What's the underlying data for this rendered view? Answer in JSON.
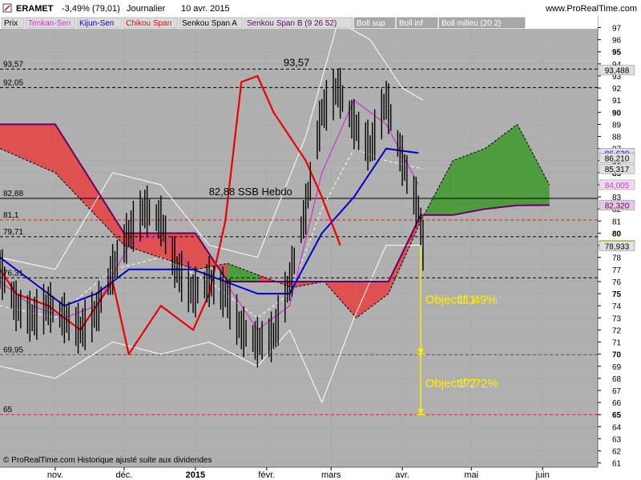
{
  "header": {
    "symbol": "ERAMET",
    "change": "-3,49% (79,01)",
    "period": "Journalier",
    "date": "10 avr. 2015",
    "site": "www.ProRealTime.com"
  },
  "legend": [
    {
      "label": "Prix",
      "color": "#000000",
      "bg": "#dcdcdc"
    },
    {
      "label": "Tenkan-Sen",
      "color": "#cc33cc",
      "bg": "#dcdcdc"
    },
    {
      "label": "Kijun-Sen",
      "color": "#0000cc",
      "bg": "#dcdcdc"
    },
    {
      "label": "Chikou Span",
      "color": "#ee0000",
      "bg": "#dcdcdc"
    },
    {
      "label": "Senkou Span A",
      "color": "#000000",
      "bg": "#dcdcdc"
    },
    {
      "label": "Senkou Span B (9 26 52)",
      "color": "#660066",
      "bg": "#dcdcdc"
    },
    {
      "label": "Boll sup",
      "color": "#ffffff",
      "bg": "#a8a8a8"
    },
    {
      "label": "Boll inf",
      "color": "#ffffff",
      "bg": "#a8a8a8"
    },
    {
      "label": "Boll milieu (20 2)",
      "color": "#ffffff",
      "bg": "#a8a8a8"
    }
  ],
  "footer": "© ProRealTime.com Historique ajusté suite aux dividendes",
  "colors": {
    "plot_bg": "#b0b0b0",
    "price": "#000000",
    "tenkan": "#cc33cc",
    "kijun": "#0000cc",
    "chikou": "#ee0000",
    "ssb": "#660066",
    "boll": "#ffffff",
    "cloud_bear": "#e84040",
    "cloud_bull": "#3c9a2a",
    "objective": "#ffee00"
  },
  "chart_data": {
    "type": "candlestick",
    "y_range": [
      61,
      97
    ],
    "y_ticks": [
      61,
      62,
      63,
      64,
      65,
      66,
      67,
      68,
      69,
      70,
      71,
      72,
      73,
      74,
      75,
      76,
      77,
      78,
      79,
      80,
      81,
      82,
      83,
      84,
      85,
      86,
      87,
      88,
      89,
      90,
      91,
      92,
      93,
      94,
      95,
      96,
      97
    ],
    "y_bold_ticks": [
      65,
      70,
      75,
      80,
      85,
      90,
      95
    ],
    "x_labels": [
      {
        "date": "2014-11-01",
        "label": "nov."
      },
      {
        "date": "2014-12-01",
        "label": "déc."
      },
      {
        "date": "2015-01-01",
        "label": "2015"
      },
      {
        "date": "2015-02-01",
        "label": "févr."
      },
      {
        "date": "2015-03-01",
        "label": "mars"
      },
      {
        "date": "2015-04-01",
        "label": "avr."
      },
      {
        "date": "2015-05-01",
        "label": "mai"
      },
      {
        "date": "2015-06-01",
        "label": "juin"
      }
    ],
    "x_range": [
      "2014-10-08",
      "2015-06-25"
    ],
    "levels": [
      {
        "value": 93.57,
        "label": "93,57",
        "style": "dashed-black"
      },
      {
        "value": 92.05,
        "label": "92,05",
        "style": "dashed-black"
      },
      {
        "value": 82.88,
        "label": "82,88",
        "style": "solid-black"
      },
      {
        "value": 81.1,
        "label": "81,1",
        "style": "dashed-red"
      },
      {
        "value": 79.71,
        "label": "79,71",
        "style": "dashed-black"
      },
      {
        "value": 76.31,
        "label": "76,31",
        "style": "dashed-black"
      },
      {
        "value": 69.95,
        "label": "69,95",
        "style": "dashed-red"
      },
      {
        "value": 65,
        "label": "65",
        "style": "dashed-red"
      }
    ],
    "annotations": [
      {
        "text": "93,57",
        "date": "2015-02-14",
        "value": 93.57
      },
      {
        "text": "82,88 SSB Hebdo",
        "date": "2015-01-25",
        "value": 82.88
      },
      {
        "text": "Objectif 1",
        "date": "2015-04-11",
        "value": 74.5
      },
      {
        "text": "11,49%",
        "date": "2015-04-25",
        "value": 74.5
      },
      {
        "text": "Objectif 2",
        "date": "2015-04-11",
        "value": 67.6
      },
      {
        "text": "17,72%",
        "date": "2015-04-25",
        "value": 67.6
      }
    ],
    "objectives": {
      "date": "2015-04-09",
      "from": 79.0,
      "target1": 70,
      "target2": 65
    },
    "price_labels": [
      {
        "value": 93.488,
        "text": "93,488",
        "bg": "#e0e0e0",
        "fg": "#000000"
      },
      {
        "value": 86.63,
        "text": "86,630",
        "bg": "#ddddee",
        "fg": "#0000cc"
      },
      {
        "value": 86.21,
        "text": "86,210",
        "bg": "#e0e0e0",
        "fg": "#000000"
      },
      {
        "value": 85.317,
        "text": "85,317",
        "bg": "#e0e0e0",
        "fg": "#000000"
      },
      {
        "value": 84.005,
        "text": "84,005",
        "bg": "#eeddee",
        "fg": "#cc33cc"
      },
      {
        "value": 82.32,
        "text": "82,320",
        "bg": "#ddccdd",
        "fg": "#660066"
      },
      {
        "value": 79.01,
        "text": "79,01",
        "bg": "#ffee00",
        "fg": "#000000"
      },
      {
        "value": 78.933,
        "text": "78,933",
        "bg": "#e0e0e0",
        "fg": "#000000"
      }
    ],
    "price_series": [
      [
        "2014-10-08",
        77
      ],
      [
        "2014-10-15",
        74
      ],
      [
        "2014-10-22",
        73
      ],
      [
        "2014-10-29",
        74
      ],
      [
        "2014-11-05",
        73
      ],
      [
        "2014-11-12",
        72
      ],
      [
        "2014-11-19",
        73.5
      ],
      [
        "2014-11-26",
        77
      ],
      [
        "2014-12-03",
        80
      ],
      [
        "2014-12-10",
        82
      ],
      [
        "2014-12-17",
        81
      ],
      [
        "2014-12-24",
        77
      ],
      [
        "2014-12-31",
        75
      ],
      [
        "2015-01-07",
        76
      ],
      [
        "2015-01-14",
        75
      ],
      [
        "2015-01-21",
        72
      ],
      [
        "2015-01-28",
        71
      ],
      [
        "2015-02-04",
        71.5
      ],
      [
        "2015-02-11",
        76
      ],
      [
        "2015-02-18",
        82
      ],
      [
        "2015-02-25",
        90
      ],
      [
        "2015-03-04",
        92
      ],
      [
        "2015-03-11",
        89
      ],
      [
        "2015-03-18",
        87
      ],
      [
        "2015-03-25",
        91
      ],
      [
        "2015-04-01",
        86
      ],
      [
        "2015-04-08",
        82
      ],
      [
        "2015-04-10",
        79.01
      ]
    ],
    "tenkan": [
      [
        "2014-10-08",
        76
      ],
      [
        "2014-10-22",
        74
      ],
      [
        "2014-11-05",
        73
      ],
      [
        "2014-11-19",
        74
      ],
      [
        "2014-12-03",
        79
      ],
      [
        "2014-12-17",
        80
      ],
      [
        "2014-12-31",
        77
      ],
      [
        "2015-01-14",
        76
      ],
      [
        "2015-01-28",
        72
      ],
      [
        "2015-02-11",
        74
      ],
      [
        "2015-02-25",
        85
      ],
      [
        "2015-03-11",
        91
      ],
      [
        "2015-03-25",
        89
      ],
      [
        "2015-04-08",
        84.005
      ]
    ],
    "kijun": [
      [
        "2014-10-08",
        78
      ],
      [
        "2014-10-22",
        76
      ],
      [
        "2014-11-05",
        74
      ],
      [
        "2014-11-19",
        75
      ],
      [
        "2014-12-03",
        77
      ],
      [
        "2014-12-17",
        77
      ],
      [
        "2014-12-31",
        77
      ],
      [
        "2015-01-14",
        76
      ],
      [
        "2015-01-28",
        75
      ],
      [
        "2015-02-11",
        75
      ],
      [
        "2015-02-25",
        80
      ],
      [
        "2015-03-11",
        83
      ],
      [
        "2015-03-25",
        87
      ],
      [
        "2015-04-08",
        86.63
      ]
    ],
    "chikou": [
      [
        "2014-10-08",
        77
      ],
      [
        "2014-10-15",
        75
      ],
      [
        "2014-10-29",
        74
      ],
      [
        "2014-11-12",
        72
      ],
      [
        "2014-11-26",
        76
      ],
      [
        "2014-12-03",
        70
      ],
      [
        "2014-12-17",
        74
      ],
      [
        "2014-12-31",
        72
      ],
      [
        "2015-01-07",
        75
      ],
      [
        "2015-01-14",
        81
      ],
      [
        "2015-01-21",
        92.5
      ],
      [
        "2015-01-28",
        93
      ],
      [
        "2015-02-04",
        90
      ],
      [
        "2015-02-11",
        88
      ],
      [
        "2015-02-18",
        86
      ],
      [
        "2015-02-25",
        83
      ],
      [
        "2015-03-01",
        81
      ],
      [
        "2015-03-05",
        79
      ]
    ],
    "senkou_a": [
      [
        "2014-10-08",
        87
      ],
      [
        "2014-11-01",
        85
      ],
      [
        "2014-12-01",
        79
      ],
      [
        "2015-01-01",
        77
      ],
      [
        "2015-01-15",
        77.5
      ],
      [
        "2015-01-29",
        76.5
      ],
      [
        "2015-02-12",
        75.5
      ],
      [
        "2015-02-26",
        76
      ],
      [
        "2015-03-12",
        73
      ],
      [
        "2015-03-26",
        75
      ],
      [
        "2015-04-09",
        81
      ],
      [
        "2015-04-23",
        86
      ],
      [
        "2015-05-07",
        87
      ],
      [
        "2015-05-21",
        89
      ],
      [
        "2015-06-04",
        84
      ]
    ],
    "senkou_b": [
      [
        "2014-10-08",
        89
      ],
      [
        "2014-11-01",
        89
      ],
      [
        "2014-12-01",
        80
      ],
      [
        "2015-01-01",
        80
      ],
      [
        "2015-01-15",
        76
      ],
      [
        "2015-01-29",
        76
      ],
      [
        "2015-02-12",
        76
      ],
      [
        "2015-02-26",
        76
      ],
      [
        "2015-03-12",
        76
      ],
      [
        "2015-03-26",
        76
      ],
      [
        "2015-04-09",
        81.5
      ],
      [
        "2015-04-23",
        81.5
      ],
      [
        "2015-05-07",
        82
      ],
      [
        "2015-05-21",
        82.3
      ],
      [
        "2015-06-04",
        82.32
      ]
    ],
    "boll_sup": [
      [
        "2014-10-08",
        78
      ],
      [
        "2014-11-01",
        77
      ],
      [
        "2014-11-26",
        85
      ],
      [
        "2014-12-17",
        84
      ],
      [
        "2015-01-07",
        79
      ],
      [
        "2015-01-28",
        78
      ],
      [
        "2015-02-18",
        88
      ],
      [
        "2015-03-04",
        97.5
      ],
      [
        "2015-03-18",
        96
      ],
      [
        "2015-04-01",
        92
      ],
      [
        "2015-04-10",
        91
      ]
    ],
    "boll_inf": [
      [
        "2014-10-08",
        69
      ],
      [
        "2014-11-01",
        68
      ],
      [
        "2014-11-26",
        71
      ],
      [
        "2014-12-17",
        70
      ],
      [
        "2015-01-07",
        71
      ],
      [
        "2015-01-28",
        69
      ],
      [
        "2015-02-11",
        72
      ],
      [
        "2015-02-25",
        66
      ],
      [
        "2015-03-11",
        73
      ],
      [
        "2015-03-25",
        79
      ],
      [
        "2015-04-10",
        79
      ]
    ],
    "boll_mid": [
      [
        "2014-10-08",
        74
      ],
      [
        "2014-11-01",
        73
      ],
      [
        "2014-11-26",
        77
      ],
      [
        "2014-12-17",
        78
      ],
      [
        "2015-01-07",
        76
      ],
      [
        "2015-01-28",
        73
      ],
      [
        "2015-02-11",
        75
      ],
      [
        "2015-02-25",
        82
      ],
      [
        "2015-03-11",
        87
      ],
      [
        "2015-03-25",
        86
      ],
      [
        "2015-04-10",
        85.317
      ]
    ]
  }
}
